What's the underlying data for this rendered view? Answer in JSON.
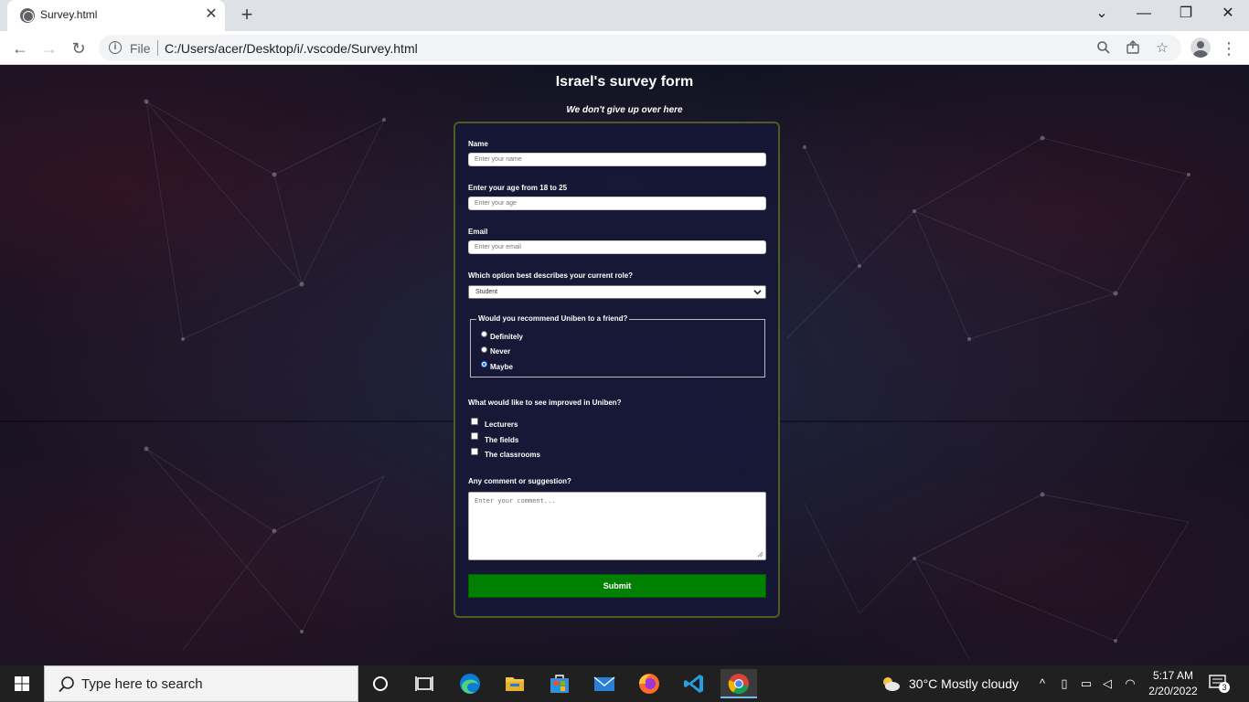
{
  "browser": {
    "tab_title": "Survey.html",
    "tab_close": "✕",
    "new_tab": "+",
    "file_label": "File",
    "url": "C:/Users/acer/Desktop/i/.vscode/Survey.html",
    "controls": {
      "minimize": "—",
      "maximize": "❐",
      "close": "✕",
      "dropdown": "⌄"
    },
    "nav": {
      "back": "←",
      "forward": "→",
      "reload": "↻"
    },
    "menu": "⋮"
  },
  "page": {
    "title": "Israel's survey form",
    "description": "We don't give up over here",
    "form": {
      "name_label": "Name",
      "name_placeholder": "Enter your name",
      "age_label": "Enter your age from 18 to 25",
      "age_placeholder": "Enter your age",
      "email_label": "Email",
      "email_placeholder": "Enter your email",
      "role_label": "Which option best describes your current role?",
      "role_selected": "Student",
      "recommend_legend": "Would you recommend Uniben to a friend?",
      "recommend_options": [
        {
          "label": "Definitely",
          "checked": false
        },
        {
          "label": "Never",
          "checked": false
        },
        {
          "label": "Maybe",
          "checked": true
        }
      ],
      "improve_label": "What would like to see improved in Uniben?",
      "improve_options": [
        "Lecturers",
        "The fields",
        "The classrooms"
      ],
      "comment_label": "Any comment or suggestion?",
      "comment_placeholder": "Enter your comment...",
      "submit_label": "Submit"
    }
  },
  "taskbar": {
    "search_text": "Type here to search",
    "weather": "30°C  Mostly cloudy",
    "time": "5:17 AM",
    "date": "2/20/2022",
    "notifications": "3"
  }
}
